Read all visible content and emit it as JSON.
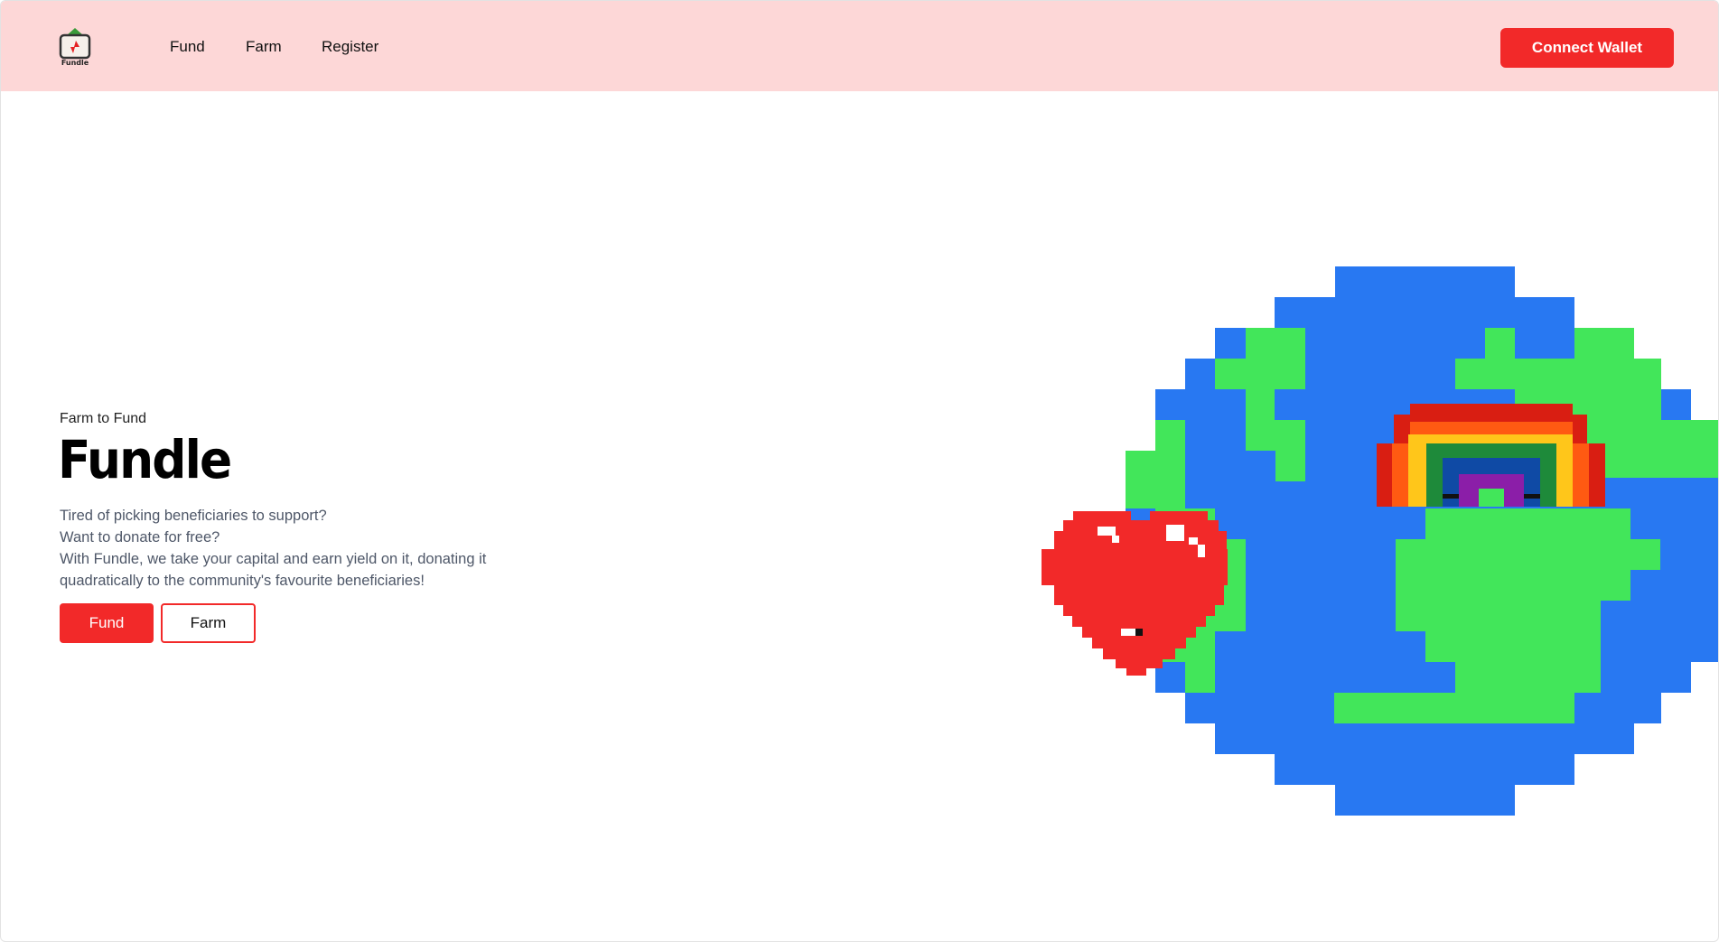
{
  "brand": {
    "logo_text": "Fundle"
  },
  "nav": {
    "items": [
      {
        "label": "Fund"
      },
      {
        "label": "Farm"
      },
      {
        "label": "Register"
      }
    ]
  },
  "header": {
    "connect_label": "Connect Wallet"
  },
  "hero": {
    "kicker": "Farm to Fund",
    "title": "Fundle",
    "lines": [
      "Tired of picking beneficiaries to support?",
      "Want to donate for free?",
      "With Fundle, we take your capital and earn yield on it, donating it",
      "quadratically to the community's favourite beneficiaries!"
    ],
    "fund_label": "Fund",
    "farm_label": "Farm"
  },
  "illustration": {
    "items": [
      "pixel-earth-icon",
      "pixel-heart-icon",
      "pixel-rainbow-icon"
    ],
    "colors": {
      "ocean": "#2878f2",
      "land": "#42e65a",
      "heart": "#f22929",
      "accent": "#f22929",
      "header_bg": "#fdd7d7"
    }
  }
}
